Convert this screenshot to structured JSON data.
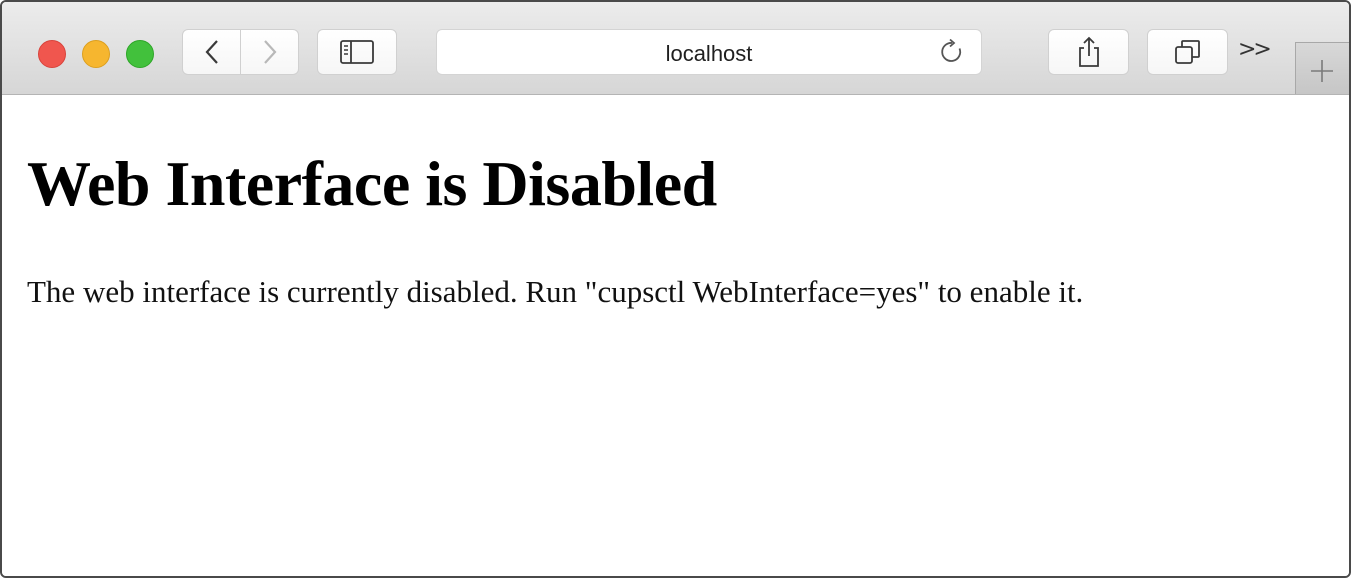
{
  "browser": {
    "address_bar": {
      "value": "localhost"
    },
    "icons": {
      "back": "chevron-left-icon",
      "forward": "chevron-right-icon",
      "sidebar": "sidebar-icon",
      "reload": "reload-icon",
      "share": "share-icon",
      "tabs": "tab-overview-icon",
      "more": "double-chevron-icon",
      "new_tab": "plus-icon"
    },
    "more_label": ">>",
    "new_tab_label": "+",
    "colors": {
      "close": "#f0564e",
      "minimize": "#f6b62f",
      "zoom": "#42c13c"
    }
  },
  "page": {
    "heading": "Web Interface is Disabled",
    "message": "The web interface is currently disabled. Run \"cupsctl WebInterface=yes\" to enable it."
  }
}
